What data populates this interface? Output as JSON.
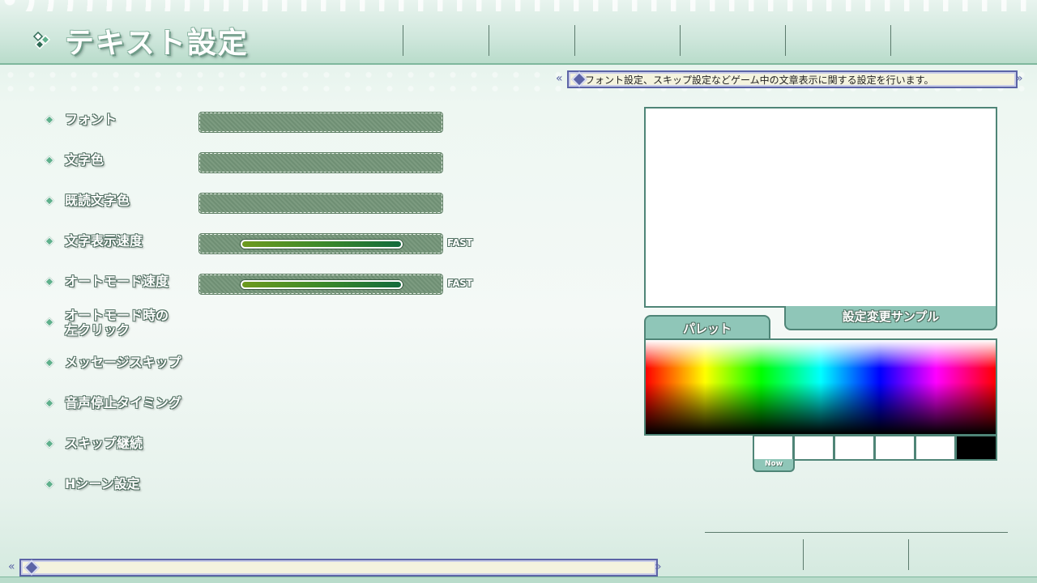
{
  "header": {
    "title": "テキスト設定",
    "nav_tabs": [
      "",
      "",
      "",
      "",
      ""
    ]
  },
  "description": "フォント設定、スキップ設定などゲーム中の文章表示に関する設定を行います。",
  "options": [
    {
      "label": "フォント"
    },
    {
      "label": "文字色"
    },
    {
      "label": "既読文字色"
    },
    {
      "label": "文字表示速度",
      "slider_end_label": "FAST"
    },
    {
      "label": "オートモード速度",
      "slider_end_label": "FAST"
    },
    {
      "label_line1": "オートモード時の",
      "label_line2": "左クリック"
    },
    {
      "label": "メッセージスキップ"
    },
    {
      "label": "音声停止タイミング"
    },
    {
      "label": "スキップ継続"
    },
    {
      "label": "Hシーン設定"
    }
  ],
  "preview": {
    "caption": "設定変更サンプル",
    "palette_tab": "パレット",
    "now_label": "Now",
    "swatches": [
      "#ffffff",
      "#ffffff",
      "#ffffff",
      "#ffffff",
      "#ffffff",
      "#000000"
    ]
  },
  "footer": {
    "status_text": "",
    "buttons": [
      "",
      "",
      ""
    ]
  },
  "colors": {
    "accent": "#8fc6b8",
    "border": "#4f8577",
    "ribbon_border": "#5c64a6"
  }
}
